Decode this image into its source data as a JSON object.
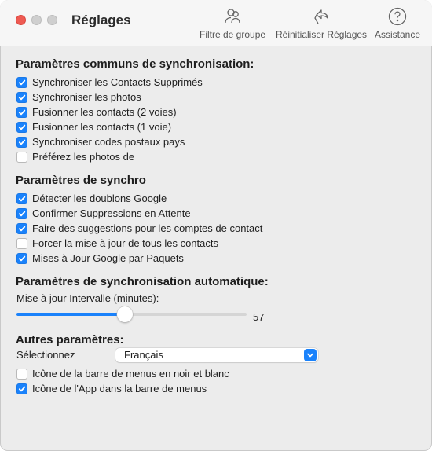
{
  "window": {
    "title": "Réglages"
  },
  "toolbar": {
    "group_filter": {
      "label": "Filtre de groupe",
      "icon": "group-filter-icon"
    },
    "reset": {
      "label": "Réinitialiser Réglages",
      "icon": "reset-icon"
    },
    "help": {
      "label": "Assistance",
      "icon": "help-icon"
    }
  },
  "common_sync": {
    "title": "Paramètres communs de synchronisation:",
    "options": [
      {
        "label": "Synchroniser les Contacts Supprimés",
        "checked": true
      },
      {
        "label": "Synchroniser les photos",
        "checked": true
      },
      {
        "label": "Fusionner les contacts (2 voies)",
        "checked": true
      },
      {
        "label": "Fusionner les contacts (1 voie)",
        "checked": true
      },
      {
        "label": "Synchroniser codes postaux pays",
        "checked": true
      },
      {
        "label": "Préférez les photos de",
        "checked": false
      }
    ]
  },
  "sync_params": {
    "title": "Paramètres de synchro",
    "options": [
      {
        "label": "Détecter les doublons Google",
        "checked": true
      },
      {
        "label": "Confirmer Suppressions en Attente",
        "checked": true
      },
      {
        "label": "Faire des suggestions pour les comptes de contact",
        "checked": true
      },
      {
        "label": "Forcer la mise à jour de tous les contacts",
        "checked": false
      },
      {
        "label": "Mises à Jour Google par Paquets",
        "checked": true
      }
    ]
  },
  "auto_sync": {
    "title": "Paramètres de synchronisation automatique:",
    "interval_label": "Mise à jour Intervalle (minutes):",
    "interval_value": "57",
    "slider_fraction": 0.47
  },
  "other": {
    "title": "Autres paramètres:",
    "select_label": "Sélectionnez",
    "language": "Français",
    "options": [
      {
        "label": "Icône de la barre de menus en noir et blanc",
        "checked": false
      },
      {
        "label": "Icône de l'App dans la barre de menus",
        "checked": true
      }
    ]
  },
  "colors": {
    "accent": "#1a82fb",
    "close": "#ee5a52"
  }
}
